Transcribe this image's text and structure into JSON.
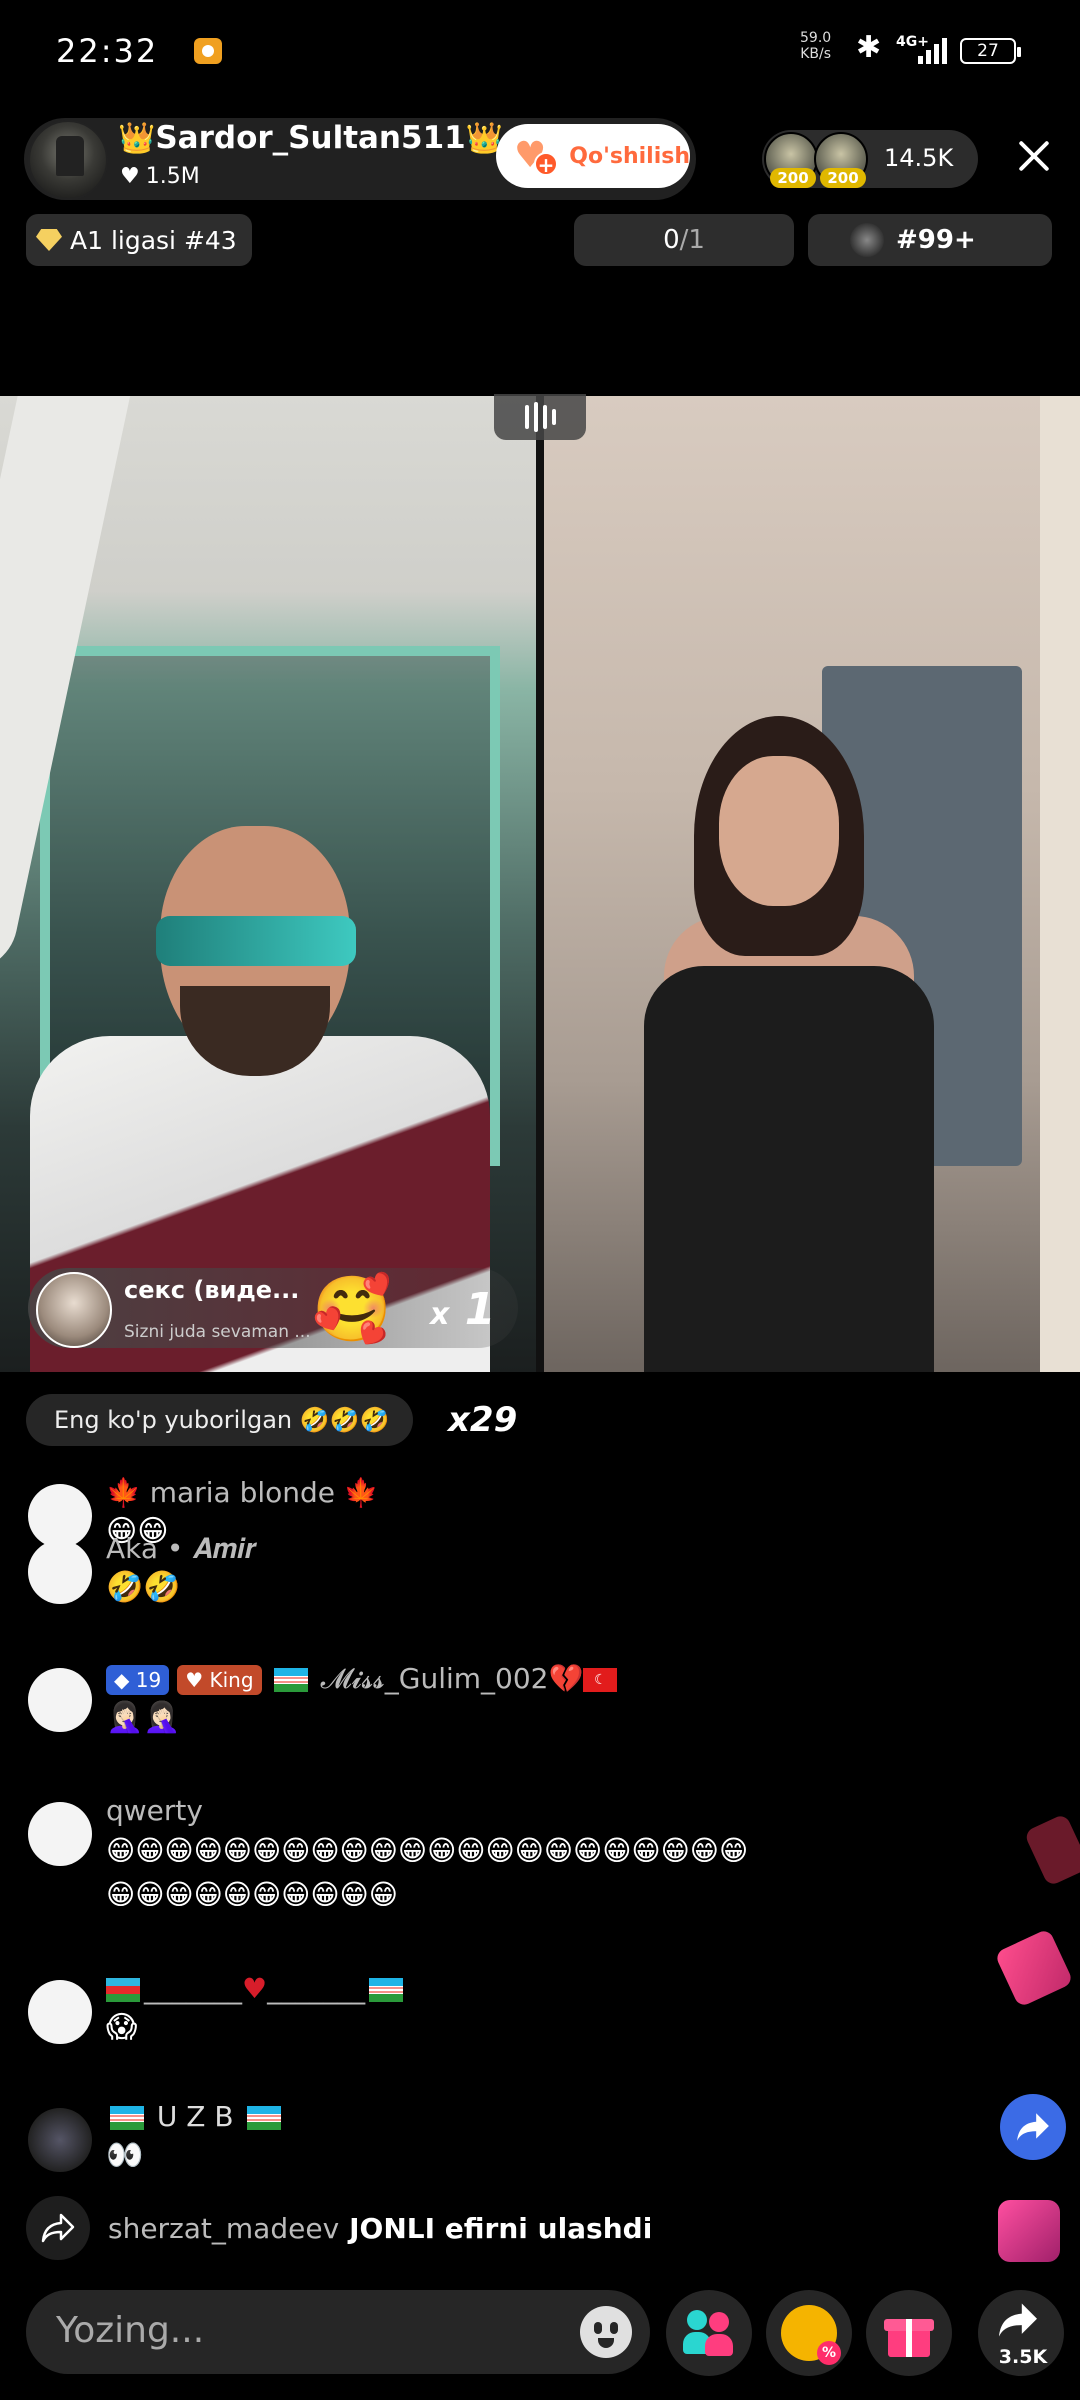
{
  "status_bar": {
    "time": "22:32",
    "speed_value": "59.0",
    "speed_unit": "KB/s",
    "network": "4G+",
    "battery": "27"
  },
  "host": {
    "name": "Sardor_Sultan511",
    "likes": "1.5M",
    "follow_label": "Qo'shilish"
  },
  "viewers": {
    "badge_1": "200",
    "badge_2": "200",
    "count": "14.5K"
  },
  "league": {
    "label": "A1 ligasi #43",
    "score_main": "0",
    "score_rest": "/1",
    "rank": "#99+"
  },
  "gift_banner": {
    "title": "секс (виде...",
    "subtitle": "Sizni juda sevaman ...",
    "emoji": "🥰",
    "count_prefix": "x",
    "count": "1"
  },
  "chat": {
    "most_sent_label": "Eng ko'p yuborilgan 🤣🤣🤣",
    "most_sent_count": "x29",
    "messages": [
      {
        "name": "maria  blonde",
        "text": "😁😁"
      },
      {
        "name": "Aka • 𝑨𝒎𝒊𝒓",
        "text": "🤣🤣"
      },
      {
        "level": "19",
        "king": "King",
        "name": "𝓜𝓲𝓼𝓼_Gulim_002",
        "text": "🤦🏻‍♀️🤦🏻‍♀️"
      },
      {
        "name": "qwerty",
        "text_line1": "😁😁😁😁😁😁😁😁😁😁😁😁😁😁😁😁😁😁😁😁😁😁",
        "text_line2": "😁😁😁😁😁😁😁😁😁😁"
      },
      {
        "name_left": "_______",
        "name_right": "_______",
        "text": "😱"
      },
      {
        "name": "U Z B",
        "text": "👀"
      }
    ],
    "join_user": "sherzat_madeev",
    "join_text": "JONLI efirni ulashdi"
  },
  "bottom_bar": {
    "input_placeholder": "Yozing...",
    "share_count": "3.5K"
  },
  "colors": {
    "accent_follow": "#ff6a3d",
    "share_blue": "#3b6be6",
    "level_badge": "#2f5fd6"
  }
}
